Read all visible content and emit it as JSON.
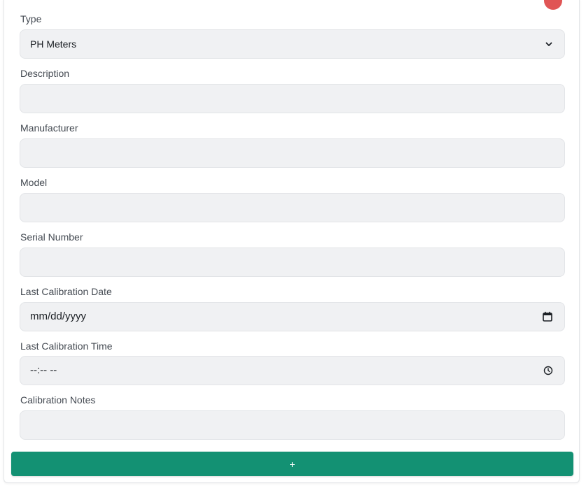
{
  "form": {
    "type": {
      "label": "Type",
      "value": "PH Meters"
    },
    "description": {
      "label": "Description",
      "value": ""
    },
    "manufacturer": {
      "label": "Manufacturer",
      "value": ""
    },
    "model": {
      "label": "Model",
      "value": ""
    },
    "serial_number": {
      "label": "Serial Number",
      "value": ""
    },
    "last_calibration_date": {
      "label": "Last Calibration Date",
      "placeholder": "mm/dd/yyyy"
    },
    "last_calibration_time": {
      "label": "Last Calibration Time",
      "placeholder": "--:-- --"
    },
    "calibration_notes": {
      "label": "Calibration Notes",
      "value": ""
    },
    "add_button": {
      "label": "+"
    }
  },
  "icons": {
    "select": "chevron-down-icon",
    "date": "calendar-icon",
    "time": "clock-icon",
    "close": "close-dot"
  },
  "colors": {
    "accent": "#139173",
    "danger": "#e05555",
    "field_bg": "#f0f1f3"
  }
}
